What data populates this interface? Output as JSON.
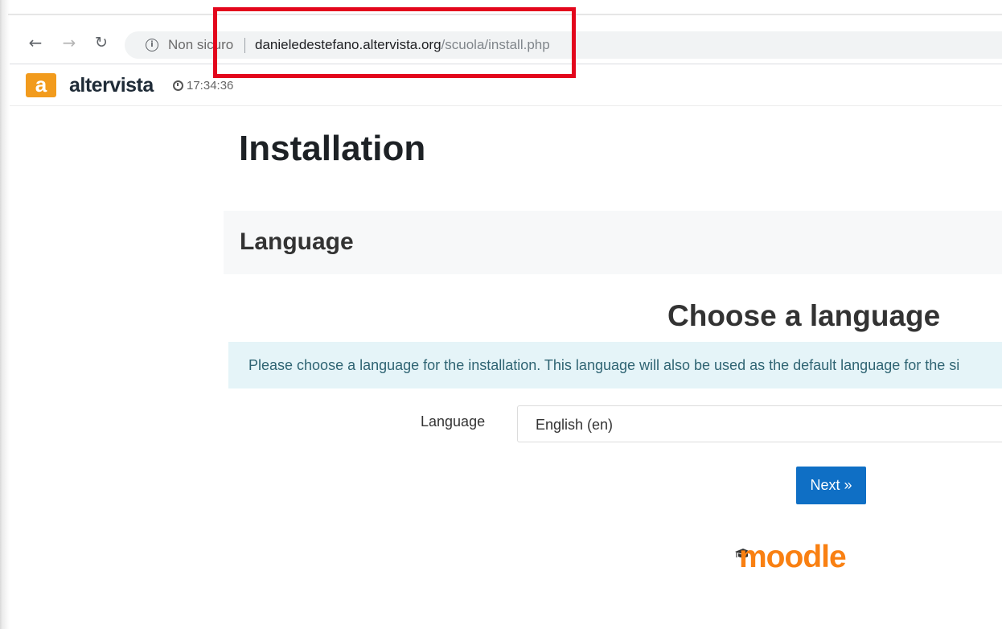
{
  "browser": {
    "security_label": "Non sicuro",
    "url_host": "danieledestefano.altervista.org",
    "url_path": "/scuola/install.php"
  },
  "altervista": {
    "logo_letter": "a",
    "name": "altervista",
    "time": "17:34:36"
  },
  "page": {
    "title": "Installation",
    "section_title": "Language",
    "heading": "Choose a language",
    "info_text": "Please choose a language for the installation. This language will also be used as the default language for the si",
    "language_label": "Language",
    "language_value": "English (en)",
    "next_label": "Next »",
    "logo_text": "moodle"
  },
  "colors": {
    "highlight": "#e3061c",
    "next_button": "#0f6fc5",
    "altervista_orange": "#f29b1d",
    "moodle_orange": "#f98012"
  },
  "icons": [
    "back-arrow-icon",
    "forward-arrow-icon",
    "reload-icon",
    "info-icon",
    "clock-icon",
    "moodle-cap-icon"
  ]
}
